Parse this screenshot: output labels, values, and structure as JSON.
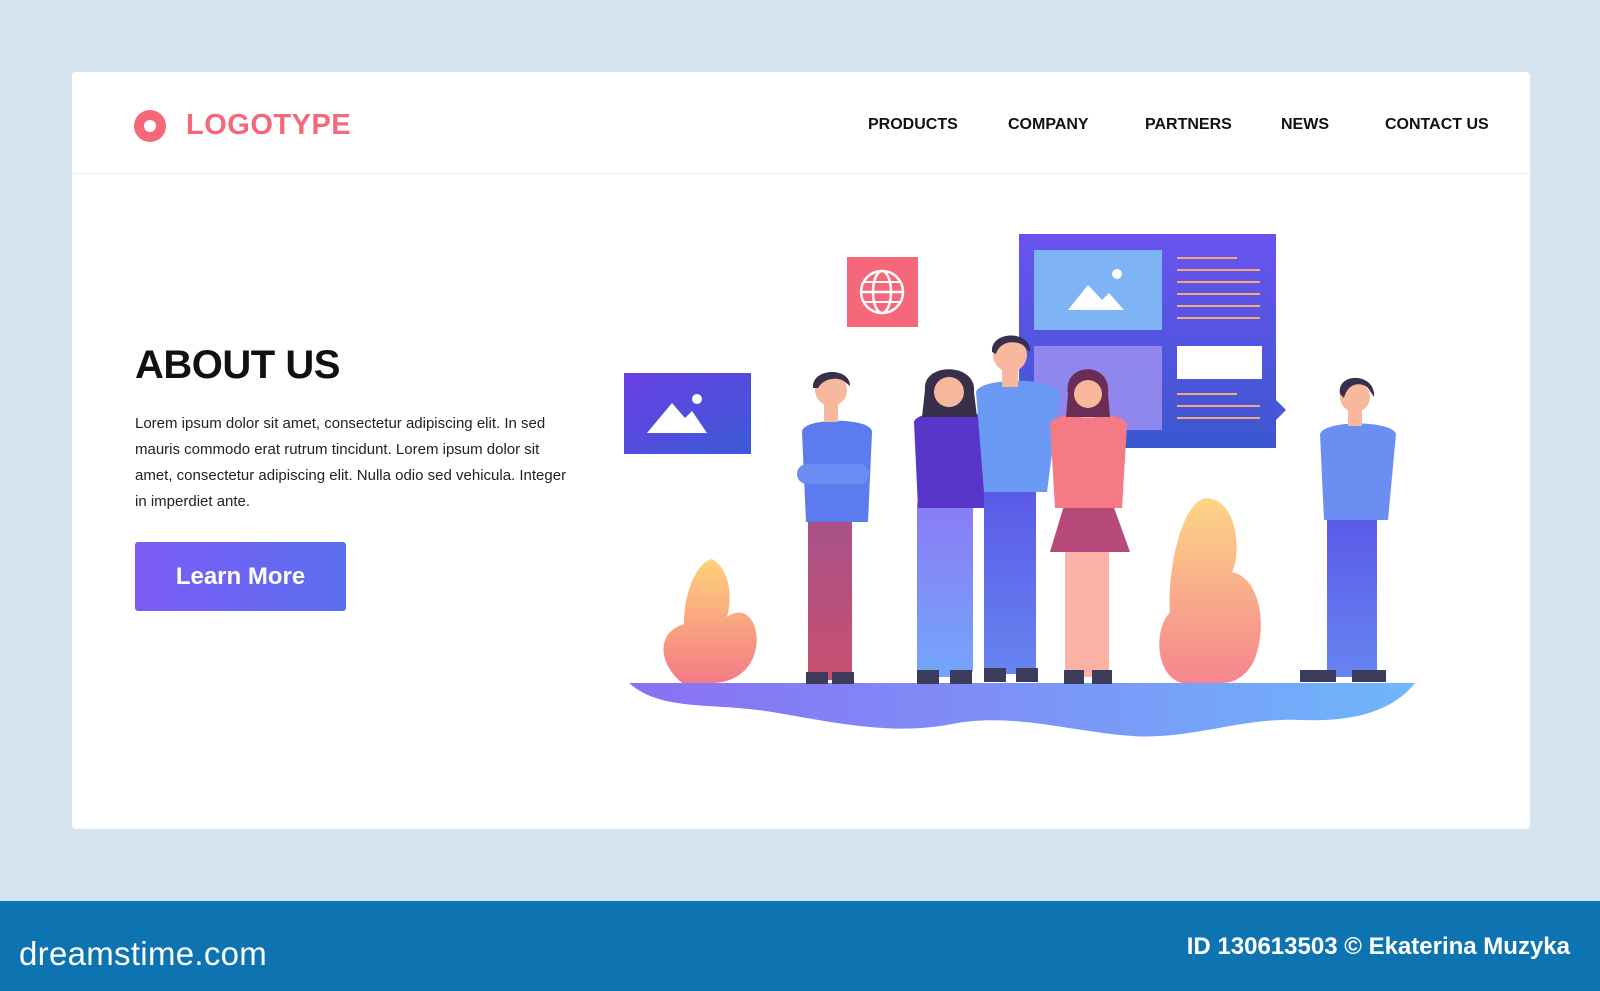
{
  "header": {
    "logo": "LOGOTYPE",
    "nav": [
      "PRODUCTS",
      "COMPANY",
      "PARTNERS",
      "NEWS",
      "CONTACT US"
    ]
  },
  "hero": {
    "title": "ABOUT US",
    "body": "Lorem ipsum dolor sit amet, consectetur adipiscing elit. In sed mauris commodo erat rutrum tincidunt. Lorem ipsum dolor sit amet, consectetur adipiscing elit. Nulla  odio sed vehicula. Integer in imperdiet ante.",
    "cta_label": "Learn More"
  },
  "watermark": {
    "brand": "dreamstime.com",
    "credit": "ID 130613503 © Ekaterina Muzyka"
  },
  "colors": {
    "accent": "#f5687a",
    "button": "#6a63f2",
    "page_bg": "#d4e3ee",
    "footer_bg": "#0e73b1"
  },
  "icons": [
    "logo-mark",
    "globe-icon",
    "image-icon"
  ]
}
